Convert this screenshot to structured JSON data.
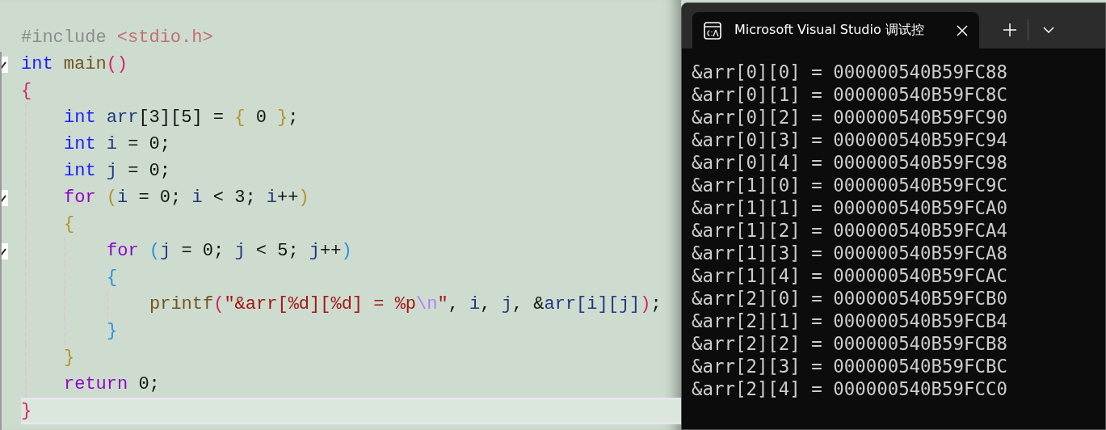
{
  "editor": {
    "lines": [
      {
        "fold_marker": false,
        "current": false,
        "tokens": [
          {
            "t": "#include",
            "color": "#8c8c8c"
          },
          {
            "t": " <stdio.h>",
            "color": "#c07070"
          }
        ]
      },
      {
        "fold_marker": true,
        "current": false,
        "tokens": [
          {
            "t": "int",
            "color": "#1a1aff"
          },
          {
            "t": " main",
            "color": "#74531f"
          },
          {
            "t": "()",
            "color": "#d6206a"
          }
        ]
      },
      {
        "fold_marker": false,
        "current": false,
        "tokens": [
          {
            "t": "{",
            "color": "#d6206a"
          }
        ],
        "children": [
          {
            "fold_marker": false,
            "current": false,
            "tokens": [
              {
                "t": "int",
                "color": "#1a1aff"
              },
              {
                "t": " arr",
                "color": "#1f377f"
              },
              {
                "t": "[3][5] =",
                "color": "#111111"
              },
              {
                "t": " {",
                "color": "#b8902a"
              },
              {
                "t": " 0",
                "color": "#111111"
              },
              {
                "t": " }",
                "color": "#b8902a"
              },
              {
                "t": ";",
                "color": "#111111"
              }
            ]
          },
          {
            "fold_marker": false,
            "current": false,
            "tokens": [
              {
                "t": "int",
                "color": "#1a1aff"
              },
              {
                "t": " i",
                "color": "#1f377f"
              },
              {
                "t": " = 0;",
                "color": "#111111"
              }
            ]
          },
          {
            "fold_marker": false,
            "current": false,
            "tokens": [
              {
                "t": "int",
                "color": "#1a1aff"
              },
              {
                "t": " j",
                "color": "#1f377f"
              },
              {
                "t": " = 0;",
                "color": "#111111"
              }
            ]
          },
          {
            "fold_marker": true,
            "current": false,
            "tokens": [
              {
                "t": "for",
                "color": "#8f08c4"
              },
              {
                "t": " (",
                "color": "#b8902a"
              },
              {
                "t": "i",
                "color": "#1f377f"
              },
              {
                "t": " = 0;",
                "color": "#111111"
              },
              {
                "t": " i",
                "color": "#1f377f"
              },
              {
                "t": " < 3;",
                "color": "#111111"
              },
              {
                "t": " i",
                "color": "#1f377f"
              },
              {
                "t": "++",
                "color": "#111111"
              },
              {
                "t": ")",
                "color": "#b8902a"
              }
            ]
          },
          {
            "fold_marker": false,
            "current": false,
            "tokens": [
              {
                "t": "{",
                "color": "#b8902a"
              }
            ],
            "children": [
              {
                "fold_marker": true,
                "current": false,
                "tokens": [
                  {
                    "t": "for",
                    "color": "#8f08c4"
                  },
                  {
                    "t": " (",
                    "color": "#2a8fdc"
                  },
                  {
                    "t": "j",
                    "color": "#1f377f"
                  },
                  {
                    "t": " = 0;",
                    "color": "#111111"
                  },
                  {
                    "t": " j",
                    "color": "#1f377f"
                  },
                  {
                    "t": " < 5;",
                    "color": "#111111"
                  },
                  {
                    "t": " j",
                    "color": "#1f377f"
                  },
                  {
                    "t": "++",
                    "color": "#111111"
                  },
                  {
                    "t": ")",
                    "color": "#2a8fdc"
                  }
                ]
              },
              {
                "fold_marker": false,
                "current": false,
                "tokens": [
                  {
                    "t": "{",
                    "color": "#2a8fdc"
                  }
                ],
                "children": [
                  {
                    "fold_marker": false,
                    "current": false,
                    "tokens": [
                      {
                        "t": "printf",
                        "color": "#74531f"
                      },
                      {
                        "t": "(",
                        "color": "#d6206a"
                      },
                      {
                        "t": "\"&arr[%d][%d] = %p",
                        "color": "#a31515"
                      },
                      {
                        "t": "\\n",
                        "color": "#b77cff"
                      },
                      {
                        "t": "\"",
                        "color": "#a31515"
                      },
                      {
                        "t": ",",
                        "color": "#111111"
                      },
                      {
                        "t": " i",
                        "color": "#1f377f"
                      },
                      {
                        "t": ",",
                        "color": "#111111"
                      },
                      {
                        "t": " j",
                        "color": "#1f377f"
                      },
                      {
                        "t": ", &",
                        "color": "#111111"
                      },
                      {
                        "t": "arr[i][j]",
                        "color": "#1f377f"
                      },
                      {
                        "t": ")",
                        "color": "#d6206a"
                      },
                      {
                        "t": ";",
                        "color": "#111111"
                      }
                    ]
                  }
                ]
              },
              {
                "fold_marker": false,
                "current": false,
                "tokens": [
                  {
                    "t": "}",
                    "color": "#2a8fdc"
                  }
                ]
              }
            ]
          },
          {
            "fold_marker": false,
            "current": false,
            "tokens": [
              {
                "t": "}",
                "color": "#b8902a"
              }
            ]
          },
          {
            "fold_marker": false,
            "current": false,
            "tokens": [
              {
                "t": "return",
                "color": "#8f08c4"
              },
              {
                "t": " 0;",
                "color": "#111111"
              }
            ]
          }
        ]
      },
      {
        "fold_marker": false,
        "current": true,
        "tokens": [
          {
            "t": "}",
            "color": "#d6206a"
          }
        ]
      }
    ]
  },
  "terminal": {
    "tab": {
      "title": "Microsoft Visual Studio 调试控",
      "selected": true
    },
    "output": [
      "&arr[0][0] = 000000540B59FC88",
      "&arr[0][1] = 000000540B59FC8C",
      "&arr[0][2] = 000000540B59FC90",
      "&arr[0][3] = 000000540B59FC94",
      "&arr[0][4] = 000000540B59FC98",
      "&arr[1][0] = 000000540B59FC9C",
      "&arr[1][1] = 000000540B59FCA0",
      "&arr[1][2] = 000000540B59FCA4",
      "&arr[1][3] = 000000540B59FCA8",
      "&arr[1][4] = 000000540B59FCAC",
      "&arr[2][0] = 000000540B59FCB0",
      "&arr[2][1] = 000000540B59FCB4",
      "&arr[2][2] = 000000540B59FCB8",
      "&arr[2][3] = 000000540B59FCBC",
      "&arr[2][4] = 000000540B59FCC0"
    ]
  }
}
